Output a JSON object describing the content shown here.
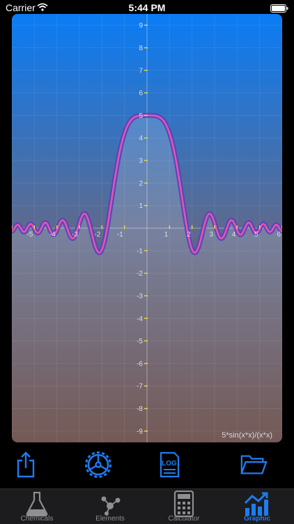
{
  "status": {
    "carrier": "Carrier",
    "time": "5:44 PM"
  },
  "graph": {
    "formula": "5*sin(x*x)/(x*x)",
    "x_ticks": [
      "-6",
      "-5",
      "-4",
      "-3",
      "-2",
      "-1",
      "1",
      "2",
      "3",
      "4",
      "5",
      "6"
    ],
    "y_ticks": [
      "9",
      "8",
      "7",
      "6",
      "5",
      "4",
      "3",
      "2",
      "1",
      "-1",
      "-2",
      "-3",
      "-4",
      "-5",
      "-6",
      "-7",
      "-8",
      "-9"
    ]
  },
  "chart_data": {
    "type": "line",
    "title": "",
    "series": [
      {
        "name": "5*sin(x*x)/(x*x)",
        "function": "5*sin(x*x)/(x*x)"
      }
    ],
    "xlim": [
      -6,
      6
    ],
    "ylim": [
      -9.5,
      9.5
    ],
    "grid": true,
    "colors": {
      "line_outer": "#5b3fc4",
      "line_inner": "#ff5ba0",
      "bg_top": "#0a7cf5",
      "bg_bottom": "#5a3a35"
    }
  },
  "toolbar": {
    "icons": [
      "share-icon",
      "gear-icon",
      "log-icon",
      "folder-icon"
    ]
  },
  "tabbar": {
    "tabs": [
      {
        "label": "Chemicals",
        "icon": "flask-icon"
      },
      {
        "label": "Elements",
        "icon": "molecule-icon"
      },
      {
        "label": "Calculator",
        "icon": "calculator-icon"
      },
      {
        "label": "Graphic",
        "icon": "chart-icon"
      }
    ],
    "active": "Graphic",
    "colors": {
      "accent": "#1e7cf0",
      "inactive": "#8e8e93"
    }
  }
}
